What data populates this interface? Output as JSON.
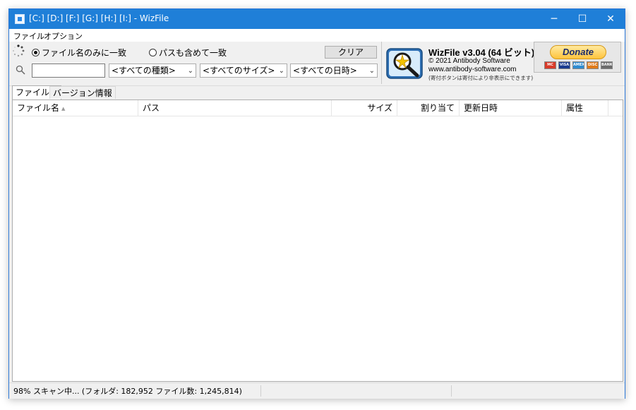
{
  "window": {
    "title": "[C:] [D:] [F:] [G:] [H:] [I:]  - WizFile",
    "controls": {
      "minimize": "─",
      "maximize": "☐",
      "close": "✕"
    }
  },
  "menu": {
    "file": "ファイル",
    "options": "オプション"
  },
  "search": {
    "radio_name_only": "ファイル名のみに一致",
    "radio_include_path": "パスも含めて一致",
    "radio_selected": "name_only",
    "input_value": "",
    "clear_label": "クリア",
    "filter_type": "<すべての種類>",
    "filter_size": "<すべてのサイズ>",
    "filter_date": "<すべての日時>"
  },
  "about": {
    "title": "WizFile v3.04 (64 ビット)",
    "copyright": "© 2021 Antibody Software",
    "url": "www.antibody-software.com",
    "note": "(寄付ボタンは寄付により非表示にできます)",
    "donate_label": "Donate",
    "card_labels": [
      "MC",
      "VISA",
      "AMEX",
      "DISC",
      "BANK"
    ]
  },
  "tabs": [
    {
      "label": "ファイル数",
      "active": true
    },
    {
      "label": "バージョン情報",
      "active": false
    }
  ],
  "table": {
    "columns": [
      "ファイル名",
      "パス",
      "サイズ",
      "割り当て",
      "更新日時",
      "属性"
    ],
    "sorted_column": "ファイル名",
    "rows": []
  },
  "status": {
    "text": "98% スキャン中... (フォルダ: 182,952  ファイル数: 1,245,814)"
  },
  "colors": {
    "titlebar": "#1f7fd8",
    "window_bg": "#f0f0f0",
    "donate_gold": "#ffc43d"
  }
}
